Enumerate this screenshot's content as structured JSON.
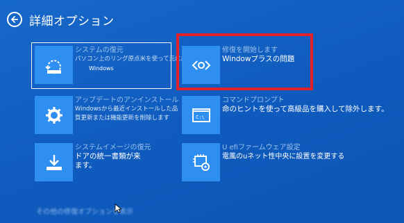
{
  "header": {
    "title": "詳細オプション"
  },
  "tiles": {
    "system_restore": {
      "title": "システムの復元",
      "line1": "パソコン上のリング原点米を使って元に戻す",
      "line2": "Windows"
    },
    "startup_repair": {
      "title": "修復を開始します",
      "line1": "Windowプラスの問題"
    },
    "uninstall_updates": {
      "title": "アップデートのアンインストール",
      "line1": "Windowsから最近インストールした品",
      "line2": "質更新または機能更新を削除します"
    },
    "command_prompt": {
      "title": "コマンドプロンプト",
      "line1": "命のヒントを使って高級品を購入して除外します。"
    },
    "system_image": {
      "title": "システムイメージの復元",
      "line1": "ドアの統一書類が来",
      "line2": "ます。"
    },
    "uefi": {
      "title": "U efiファームウェア設定",
      "line1": "電風のuネット性中央に設置を変更する"
    }
  },
  "footer": {
    "link": "その他の修復オプションを表示"
  },
  "icons": {
    "back": "back-arrow-icon",
    "restore": "system-restore-icon",
    "startup": "code-brackets-gear-icon",
    "uninstall": "gear-icon",
    "cmd": "command-prompt-icon",
    "image": "system-image-download-icon",
    "uefi": "chip-gear-icon"
  },
  "colors": {
    "background": "#0f5bbd",
    "tile": "#2f8ff0",
    "highlight": "#e3212a"
  }
}
